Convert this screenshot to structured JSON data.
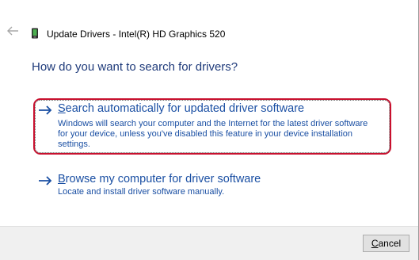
{
  "window": {
    "title": "Update Drivers - Intel(R) HD Graphics 520"
  },
  "icons": {
    "back": "back-arrow-icon",
    "device": "display-adapter-icon",
    "option_arrow": "right-arrow-icon"
  },
  "main": {
    "heading": "How do you want to search for drivers?",
    "options": [
      {
        "title_first": "S",
        "title_rest": "earch automatically for updated driver software",
        "desc_lines": [
          "Windows will search your computer and the Internet for the latest driver software",
          "for your device, unless you've disabled this feature in your device installation",
          "settings."
        ],
        "highlighted": true
      },
      {
        "title_first": "B",
        "title_rest": "rowse my computer for driver software",
        "desc_lines": [
          "Locate and install driver software manually."
        ],
        "highlighted": false
      }
    ]
  },
  "footer": {
    "cancel_first": "C",
    "cancel_rest": "ancel"
  },
  "colors": {
    "link_blue": "#1a4fa3",
    "heading_blue": "#1e3a7a",
    "highlight_red": "#c8102e",
    "footer_bg": "#f0f0f0"
  }
}
